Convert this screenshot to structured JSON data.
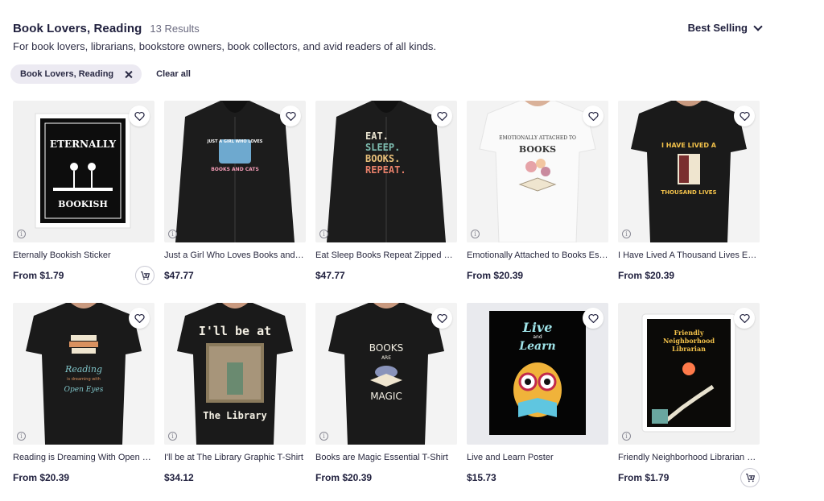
{
  "header": {
    "title": "Book Lovers, Reading",
    "results": "13 Results",
    "description": "For book lovers, librarians, bookstore owners, book collectors, and avid readers of all kinds."
  },
  "sort": {
    "label": "Best Selling",
    "icon": "chevron-down-icon"
  },
  "filters": {
    "chip_label": "Book Lovers, Reading",
    "chip_icon": "close-icon",
    "clear_label": "Clear all"
  },
  "products": [
    {
      "name": "Eternally Bookish Sticker",
      "price": "From $1.79",
      "art_text": [
        "ETERNALLY",
        "BOOKISH"
      ]
    },
    {
      "name": "Just a Girl Who Loves Books and Cats Hoodie",
      "price": "$47.77",
      "art_text": [
        "JUST A GIRL WHO LOVES",
        "BOOKS AND CATS"
      ]
    },
    {
      "name": "Eat Sleep Books Repeat Zipped Hoodie",
      "price": "$47.77",
      "art_text": [
        "EAT.",
        "SLEEP.",
        "BOOKS.",
        "REPEAT."
      ]
    },
    {
      "name": "Emotionally Attached to Books Essential T-Shirt",
      "price": "From $20.39",
      "art_text": [
        "EMOTIONALLY ATTACHED TO",
        "BOOKS"
      ]
    },
    {
      "name": "I Have Lived A Thousand Lives Essential T-Shirt",
      "price": "From $20.39",
      "art_text": [
        "I HAVE LIVED A",
        "THOUSAND LIVES"
      ]
    },
    {
      "name": "Reading is Dreaming With Open Eyes T-Shirt",
      "price": "From $20.39",
      "art_text": [
        "Reading",
        "is dreaming with",
        "Open Eyes"
      ]
    },
    {
      "name": "I'll be at The Library Graphic T-Shirt",
      "price": "$34.12",
      "art_text": [
        "I'll be at",
        "The Library"
      ]
    },
    {
      "name": "Books are Magic Essential T-Shirt",
      "price": "From $20.39",
      "art_text": [
        "BOOKS",
        "ARE",
        "MAGIC"
      ]
    },
    {
      "name": "Live and Learn Poster",
      "price": "$15.73",
      "art_text": [
        "Live",
        "and",
        "Learn"
      ]
    },
    {
      "name": "Friendly Neighborhood Librarian Sticker",
      "price": "From $1.79",
      "art_text": [
        "Friendly",
        "Neighborhood",
        "Librarian"
      ]
    }
  ],
  "icons": {
    "favorite": "heart-icon",
    "info": "info-icon",
    "cart": "add-to-cart-icon"
  },
  "colors": {
    "text_dark": "#1f1f3d",
    "chip_bg": "#eceaf2",
    "tile_bg": "#f1f1f1"
  }
}
